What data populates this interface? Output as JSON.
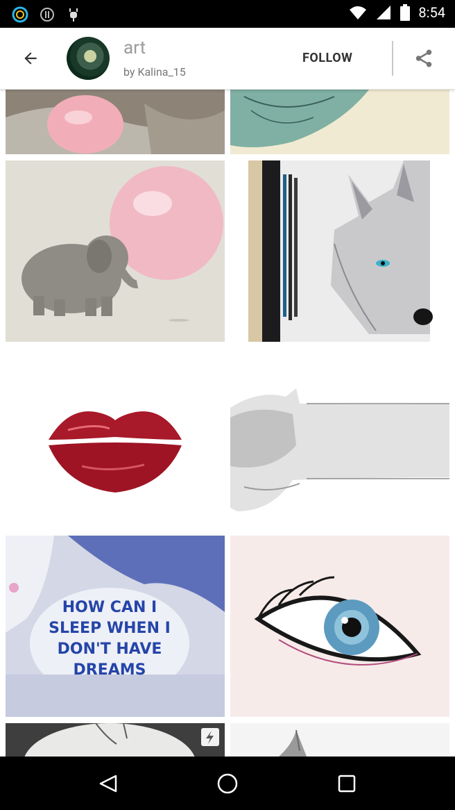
{
  "status_bar": {
    "time": "8:54",
    "icons": [
      "ring-app-icon",
      "info-circle-icon",
      "android-debug-icon",
      "wifi-icon",
      "signal-icon",
      "battery-icon"
    ]
  },
  "header": {
    "board_title": "art",
    "owner_text": "by Kalina_15",
    "follow_label": "FOLLOW",
    "icons": [
      "back-arrow-icon",
      "avatar",
      "share-icon"
    ]
  },
  "grid": {
    "items": [
      {
        "subject": "elephant with pink bubblegum (cropped)"
      },
      {
        "subject": "bird sketch (cropped)"
      },
      {
        "subject": "elephant blowing pink bubble"
      },
      {
        "subject": "wolf pencil drawing"
      },
      {
        "subject": "red lips"
      },
      {
        "subject": "sleeping cat sketch"
      },
      {
        "subject": "blue illustration with text"
      },
      {
        "subject": "eye drawing"
      },
      {
        "subject": "moon photo (cropped)"
      },
      {
        "subject": "sketch (cropped)"
      }
    ],
    "artwork_text": "HOW CAN I SLEEP WHEN I DON'T HAVE DREAMS"
  },
  "nav_bar": {
    "icons": [
      "back-triangle-icon",
      "home-circle-icon",
      "recents-square-icon"
    ]
  }
}
